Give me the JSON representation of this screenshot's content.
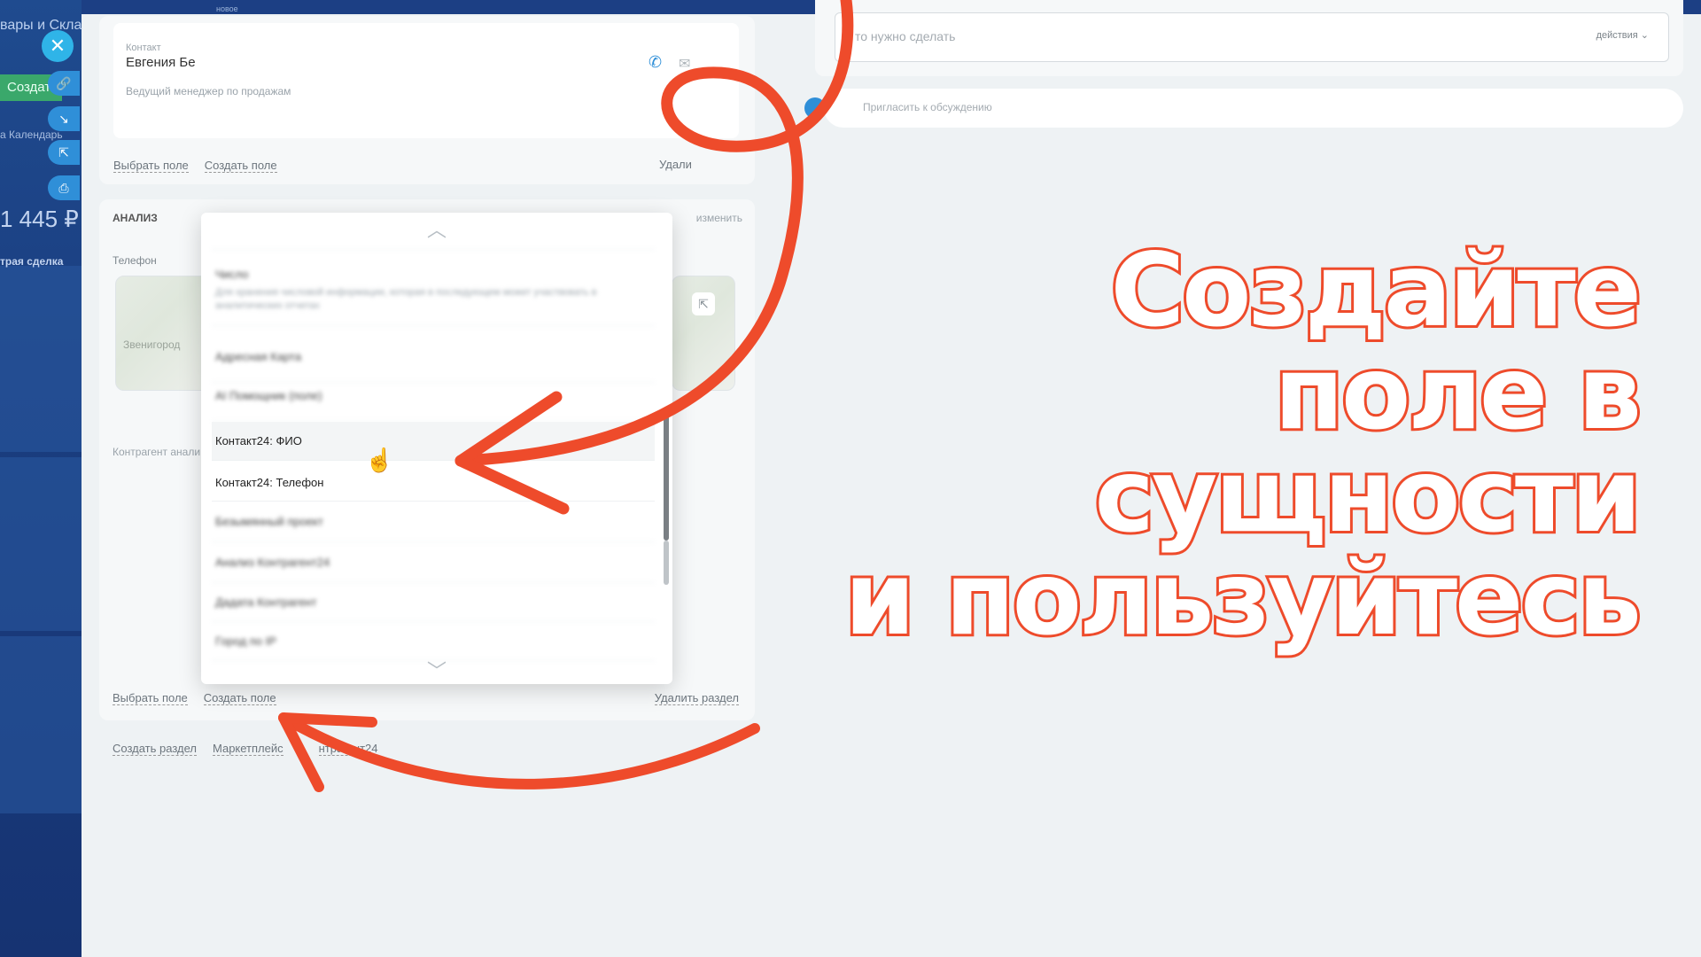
{
  "top": {
    "small_label": "новое"
  },
  "left": {
    "title": "вары и Скла",
    "create_label": "Создат",
    "tabs": "а   Календарь",
    "amount": "1 445 ₽",
    "deal": "трая сделка"
  },
  "contact": {
    "label": "Контакт",
    "name": "Евгения Бе",
    "position": "Ведущий менеджер по продажам",
    "links": [
      "Выбрать поле",
      "Создать поле"
    ],
    "delete_label": "Удали"
  },
  "analysis": {
    "title": "АНАЛИЗ",
    "edit": "изменить",
    "phone_label": "Телефон",
    "map_city": "Звенигород",
    "kontr_label": "Контрагент анали",
    "links": [
      "Выбрать поле",
      "Создать поле"
    ],
    "delete_section": "Удалить раздел"
  },
  "bottom_links": [
    "Создать раздел",
    "Маркетплейс",
    "нтрагент24"
  ],
  "dropdown": {
    "items": [
      {
        "label": "Число",
        "desc": "Для хранения числовой информации, которая в последующем может участвовать в аналитических отчетах",
        "blurred": true
      },
      {
        "label": "Адресная Карта",
        "blurred": true
      },
      {
        "label": "AI Помощник (поле)",
        "blurred": true
      },
      {
        "label": "Контакт24: ФИО",
        "blurred": false,
        "hovered": true
      },
      {
        "label": "Контакт24: Телефон",
        "blurred": false
      },
      {
        "label": "Безымянный проект",
        "blurred": true
      },
      {
        "label": "Анализ Контрагент24",
        "blurred": true
      },
      {
        "label": "Дадата Контрагент",
        "blurred": true
      },
      {
        "label": "Город по IP",
        "blurred": true
      }
    ]
  },
  "right": {
    "todo_placeholder": "то нужно сделать",
    "actions_label": "действия ⌄",
    "invite_text": "Пригласить к обсуждению"
  },
  "headline": {
    "lines": [
      "Создайте",
      "поле в",
      "сущности",
      "и пользуйтесь"
    ],
    "stroke_color": "#ee4b2b"
  }
}
